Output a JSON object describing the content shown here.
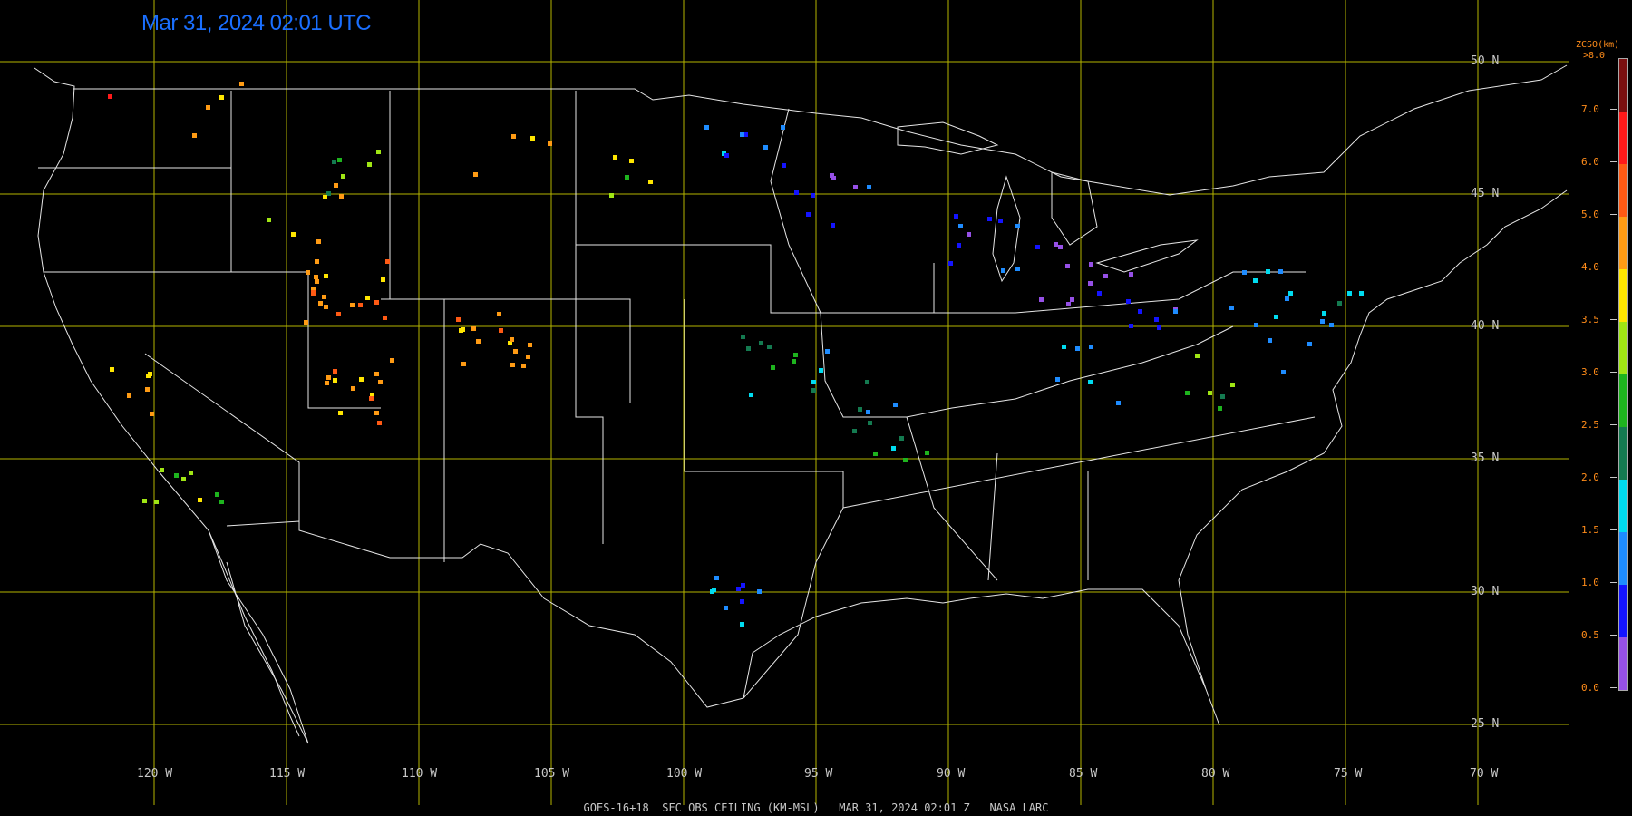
{
  "title": "Mar 31, 2024 02:01 UTC",
  "footer": "GOES-16+18  SFC OBS CEILING (KM-MSL)   MAR 31, 2024 02:01 Z   NASA LARC",
  "latitude_labels": [
    "50 N",
    "45 N",
    "40 N",
    "35 N",
    "30 N",
    "25 N"
  ],
  "longitude_labels": [
    "120 W",
    "115 W",
    "110 W",
    "105 W",
    "100 W",
    "95 W",
    "90 W",
    "85 W",
    "80 W",
    "75 W",
    "70 W"
  ],
  "legend": {
    "title": "ZCSO(km)",
    "top_label": ">8.0",
    "labels": [
      "7.0",
      "6.0",
      "5.0",
      "4.0",
      "3.5",
      "3.0",
      "2.5",
      "2.0",
      "1.5",
      "1.0",
      "0.5",
      "0.0"
    ],
    "colors": [
      "#7a1010",
      "#ff1a1a",
      "#ff5a14",
      "#ff9b14",
      "#ffe600",
      "#a0e614",
      "#1eb41e",
      "#147a50",
      "#00dcf0",
      "#1e8cff",
      "#1414ff",
      "#9650e6"
    ]
  },
  "colors": {
    "grid": "#b4b400",
    "coast": "#e6e6e6",
    "title": "#1a6fff"
  }
}
